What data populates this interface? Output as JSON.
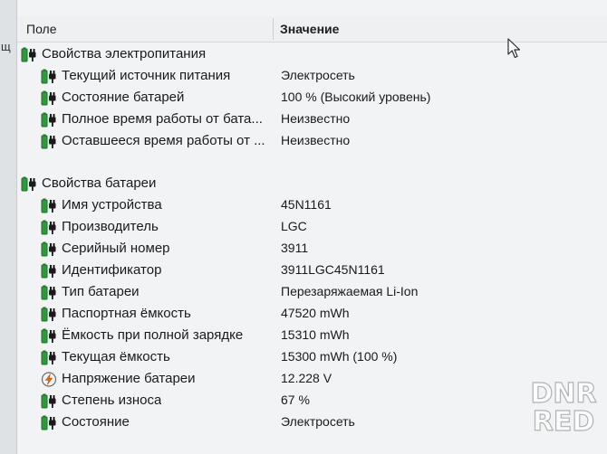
{
  "left_cut_text": "щ",
  "columns": {
    "field": "Поле",
    "value": "Значение"
  },
  "power_group": {
    "title": "Свойства электропитания",
    "rows": [
      {
        "label": "Текущий источник питания",
        "value": "Электросеть",
        "icon": "battery-icon"
      },
      {
        "label": "Состояние батарей",
        "value": "100 % (Высокий уровень)",
        "icon": "battery-icon"
      },
      {
        "label": "Полное время работы от бата...",
        "value": "Неизвестно",
        "icon": "battery-icon"
      },
      {
        "label": "Оставшееся время работы от ...",
        "value": "Неизвестно",
        "icon": "battery-icon"
      }
    ]
  },
  "battery_group": {
    "title": "Свойства батареи",
    "rows": [
      {
        "label": "Имя устройства",
        "value": "45N1161",
        "icon": "battery-icon"
      },
      {
        "label": "Производитель",
        "value": "LGC",
        "icon": "battery-icon"
      },
      {
        "label": "Серийный номер",
        "value": "3911",
        "icon": "battery-icon"
      },
      {
        "label": "Идентификатор",
        "value": "3911LGC45N1161",
        "icon": "battery-icon"
      },
      {
        "label": "Тип батареи",
        "value": "Перезаряжаемая Li-Ion",
        "icon": "battery-icon"
      },
      {
        "label": "Паспортная ёмкость",
        "value": "47520 mWh",
        "icon": "battery-icon"
      },
      {
        "label": "Ёмкость при полной зарядке",
        "value": "15310 mWh",
        "icon": "battery-icon"
      },
      {
        "label": "Текущая ёмкость",
        "value": "15300 mWh  (100 %)",
        "icon": "battery-icon"
      },
      {
        "label": "Напряжение батареи",
        "value": "12.228 V",
        "icon": "voltage-icon"
      },
      {
        "label": "Степень износа",
        "value": "67 %",
        "icon": "battery-icon"
      },
      {
        "label": "Состояние",
        "value": "Электросеть",
        "icon": "battery-icon"
      }
    ]
  },
  "watermark": {
    "line1": "DNR",
    "line2": "RED"
  },
  "colors": {
    "battery_green": "#2f9a3b",
    "battery_dark": "#1f6f2a",
    "plug": "#1a1a1a"
  }
}
